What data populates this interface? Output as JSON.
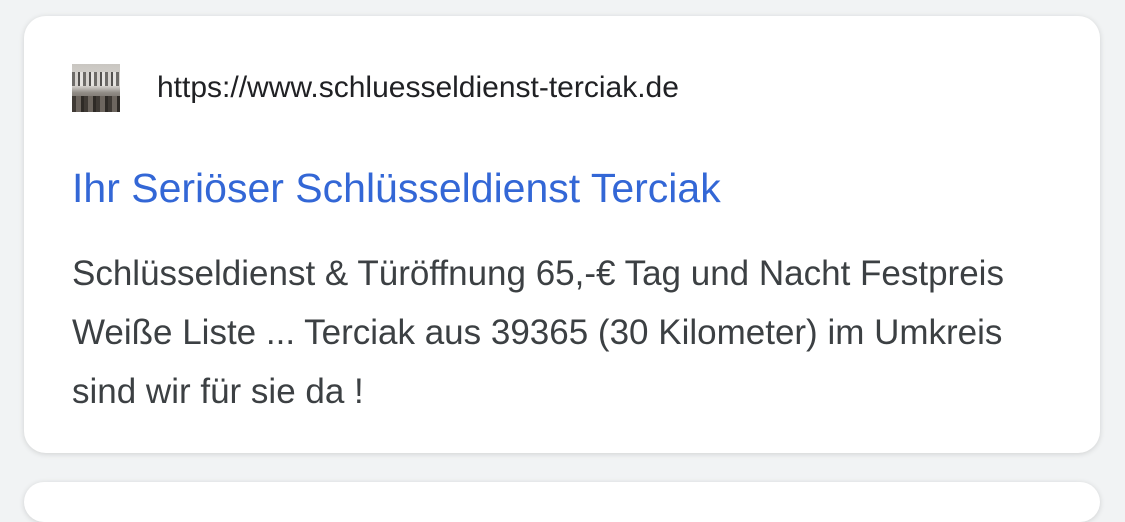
{
  "result": {
    "favicon_icon": "site-thumbnail-icon",
    "url": "https://www.schluesseldienst-terciak.de",
    "title": "Ihr Seriöser Schlüsseldienst Terciak",
    "snippet": "Schlüsseldienst & Türöffnung 65,-€ Tag und Nacht Festpreis Weiße Liste ... Terciak aus 39365 (30 Kilometer) im Umkreis sind wir für sie da !"
  },
  "colors": {
    "title_link": "#3367d6",
    "url_text": "#202124",
    "snippet_text": "#3c4043",
    "card_background": "#ffffff",
    "page_background": "#f1f3f4"
  }
}
